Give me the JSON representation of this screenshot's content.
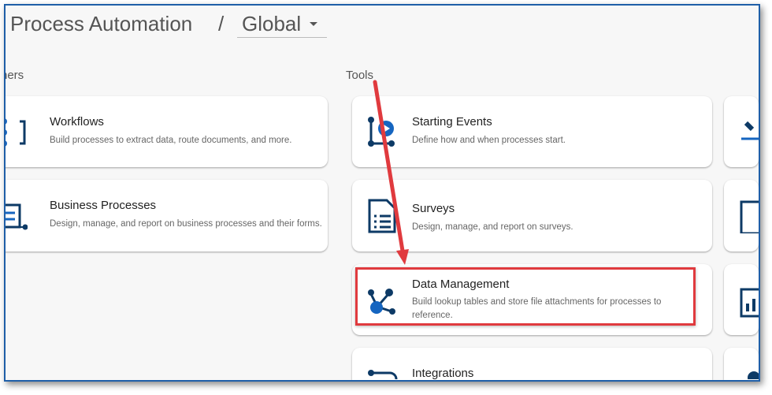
{
  "header": {
    "title": "Process Automation",
    "separator": "/",
    "scope": "Global"
  },
  "sections": {
    "left_label": "hers",
    "tools_label": "Tools"
  },
  "left_cards": [
    {
      "title": "Workflows",
      "description": "Build processes to extract data, route documents, and more.",
      "icon": "workflow-icon"
    },
    {
      "title": "Business Processes",
      "description": "Design, manage, and report on business processes and their forms.",
      "icon": "business-process-icon"
    }
  ],
  "tool_cards": [
    {
      "title": "Starting Events",
      "description": "Define how and when processes start.",
      "icon": "starting-events-icon"
    },
    {
      "title": "Surveys",
      "description": "Design, manage, and report on surveys.",
      "icon": "survey-icon"
    },
    {
      "title": "Data Management",
      "description": "Build lookup tables and store file attachments for processes to reference.",
      "icon": "data-management-icon"
    },
    {
      "title": "Integrations",
      "description": "",
      "icon": "integrations-icon"
    }
  ],
  "colors": {
    "icon": "#0d3a66",
    "accent": "#1565c0",
    "annotation": "#e03a3e",
    "frame": "#1f5fa8"
  }
}
